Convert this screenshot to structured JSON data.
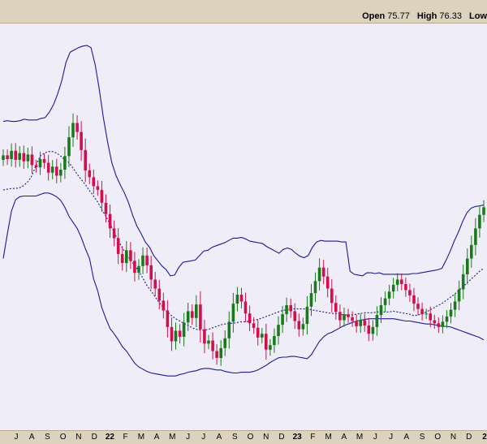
{
  "header": {
    "open_label": "Open",
    "open_value": "75.77",
    "high_label": "High",
    "high_value": "76.33",
    "low_label": "Low"
  },
  "chart_data": {
    "type": "candlestick",
    "indicators": [
      "Bollinger Bands upper",
      "Bollinger Bands middle (dotted)",
      "Bollinger Bands lower"
    ],
    "colors": {
      "up": "#1a7a1a",
      "down": "#d0104c",
      "band": "#1b1b8f",
      "background": "#efedf8",
      "header": "#ddd2be"
    },
    "x_tick_labels": [
      "J",
      "A",
      "S",
      "O",
      "N",
      "D",
      "22",
      "F",
      "M",
      "A",
      "M",
      "J",
      "J",
      "A",
      "S",
      "O",
      "N",
      "D",
      "23",
      "F",
      "M",
      "A",
      "M",
      "J",
      "J",
      "A",
      "S",
      "O",
      "N",
      "D",
      "2"
    ],
    "close_series": [
      82.5,
      82.0,
      83.1,
      81.9,
      82.8,
      81.7,
      82.6,
      81.2,
      80.9,
      82.0,
      81.5,
      80.2,
      81.0,
      79.8,
      80.6,
      82.4,
      84.9,
      86.8,
      85.6,
      83.2,
      80.5,
      79.6,
      78.4,
      77.9,
      76.2,
      74.7,
      72.8,
      71.5,
      69.4,
      68.2,
      69.9,
      68.5,
      66.9,
      67.8,
      69.2,
      67.9,
      66.0,
      64.8,
      63.2,
      61.9,
      59.7,
      57.8,
      59.2,
      58.4,
      60.3,
      61.8,
      60.9,
      62.7,
      59.4,
      57.5,
      57.9,
      56.5,
      55.6,
      56.9,
      58.2,
      60.4,
      62.8,
      64.0,
      63.1,
      61.5,
      60.2,
      59.6,
      58.3,
      58.8,
      56.7,
      57.3,
      58.5,
      60.0,
      61.4,
      62.6,
      61.8,
      60.5,
      59.4,
      60.1,
      62.4,
      64.2,
      65.8,
      67.6,
      66.4,
      64.8,
      62.9,
      61.7,
      60.6,
      61.4,
      61.0,
      60.5,
      59.8,
      60.6,
      59.9,
      58.8,
      59.7,
      61.3,
      62.6,
      63.5,
      64.4,
      65.3,
      66.0,
      65.4,
      64.6,
      63.9,
      62.8,
      62.1,
      61.4,
      61.5,
      60.6,
      60.2,
      59.7,
      60.4,
      61.1,
      62.0,
      63.1,
      64.7,
      66.7,
      68.8,
      70.6,
      72.8,
      74.6,
      75.6
    ],
    "bollinger": {
      "upper": [
        87.0,
        87.1,
        87.0,
        87.0,
        87.1,
        87.3,
        87.2,
        87.2,
        87.2,
        87.4,
        87.5,
        88.2,
        89.2,
        90.6,
        92.4,
        94.8,
        96.2,
        96.5,
        96.8,
        97.0,
        97.1,
        96.8,
        94.5,
        91.2,
        87.4,
        84.2,
        81.5,
        79.8,
        78.6,
        77.5,
        76.2,
        74.5,
        73.1,
        72.1,
        71.0,
        70.3,
        69.2,
        68.5,
        67.8,
        67.3,
        66.5,
        66.6,
        67.6,
        68.3,
        68.4,
        68.5,
        68.6,
        69.2,
        69.8,
        69.9,
        70.3,
        70.5,
        70.7,
        70.9,
        71.2,
        71.5,
        71.5,
        71.6,
        71.4,
        71.1,
        71.0,
        70.9,
        70.8,
        70.4,
        70.1,
        69.8,
        69.5,
        70.0,
        70.2,
        70.0,
        69.5,
        69.1,
        68.9,
        69.2,
        70.3,
        71.0,
        71.2,
        71.1,
        71.1,
        71.1,
        71.1,
        71.0,
        71.0,
        67.1,
        66.7,
        66.6,
        66.5,
        66.9,
        66.9,
        66.8,
        66.9,
        66.7,
        66.7,
        66.7,
        66.7,
        66.7,
        66.7,
        66.7,
        66.8,
        66.8,
        66.9,
        67.0,
        67.1,
        67.2,
        67.3,
        67.5,
        68.6,
        69.8,
        71.2,
        72.4,
        73.8,
        74.9,
        75.5,
        75.7,
        75.8,
        75.9
      ],
      "middle": [
        77.9,
        78.0,
        78.1,
        78.1,
        78.2,
        78.5,
        79.0,
        79.8,
        81.2,
        82.4,
        82.8,
        83.0,
        83.0,
        82.8,
        82.4,
        81.9,
        81.5,
        80.8,
        80.0,
        79.3,
        78.6,
        77.8,
        77.1,
        76.3,
        75.3,
        74.4,
        73.4,
        72.3,
        71.2,
        70.2,
        69.4,
        68.6,
        67.9,
        67.1,
        66.2,
        65.2,
        64.5,
        63.7,
        62.9,
        62.3,
        61.7,
        61.2,
        60.8,
        60.5,
        60.2,
        59.9,
        59.6,
        59.4,
        59.3,
        59.3,
        59.4,
        59.6,
        59.8,
        60.0,
        60.1,
        60.2,
        60.2,
        60.3,
        60.4,
        60.4,
        60.5,
        60.6,
        60.7,
        60.9,
        61.1,
        61.3,
        61.5,
        61.7,
        61.9,
        62.0,
        62.1,
        62.1,
        62.1,
        62.1,
        62.1,
        62.0,
        61.9,
        61.8,
        61.7,
        61.6,
        61.5,
        61.5,
        61.4,
        61.3,
        61.3,
        61.3,
        61.4,
        61.5,
        61.6,
        61.6,
        61.6,
        61.7,
        61.7,
        61.7,
        61.7,
        61.8,
        61.7,
        61.6,
        61.5,
        61.4,
        61.2,
        61.3,
        61.5,
        61.7,
        62.0,
        62.3,
        62.6,
        62.9,
        63.3,
        63.7,
        64.1,
        64.6,
        65.1,
        65.6,
        66.1,
        66.6,
        67.1,
        67.5
      ],
      "lower": [
        68.8,
        72.1,
        75.1,
        76.6,
        77.0,
        77.1,
        77.1,
        77.1,
        77.1,
        77.3,
        77.5,
        77.5,
        77.3,
        77.0,
        76.5,
        75.6,
        74.4,
        73.6,
        72.8,
        71.6,
        70.1,
        68.8,
        66.1,
        64.5,
        62.3,
        60.8,
        59.5,
        58.8,
        58.0,
        57.1,
        56.5,
        55.7,
        54.9,
        54.4,
        54.1,
        53.8,
        53.6,
        53.5,
        53.4,
        53.3,
        53.2,
        53.2,
        53.2,
        53.4,
        53.5,
        53.7,
        53.8,
        53.9,
        54.1,
        54.2,
        54.2,
        54.1,
        54.0,
        54.0,
        53.8,
        53.7,
        53.6,
        53.6,
        53.7,
        53.7,
        53.7,
        53.8,
        54.0,
        54.3,
        54.6,
        55.0,
        55.3,
        55.6,
        55.7,
        55.7,
        55.8,
        55.8,
        55.7,
        55.6,
        55.5,
        56.0,
        56.9,
        57.8,
        58.4,
        58.8,
        59.0,
        59.3,
        59.6,
        59.9,
        60.1,
        60.3,
        60.5,
        60.6,
        60.7,
        60.8,
        60.8,
        60.8,
        60.8,
        60.8,
        60.8,
        60.8,
        60.7,
        60.6,
        60.5,
        60.5,
        60.4,
        60.3,
        60.2,
        60.1,
        60.1,
        60.0,
        59.9,
        59.8,
        59.8,
        59.7,
        59.5,
        59.3,
        59.1,
        58.9,
        58.7,
        58.5,
        58.3,
        58.0
      ]
    },
    "ylim": [
      46,
      100
    ],
    "grid": false,
    "legend": "none"
  }
}
